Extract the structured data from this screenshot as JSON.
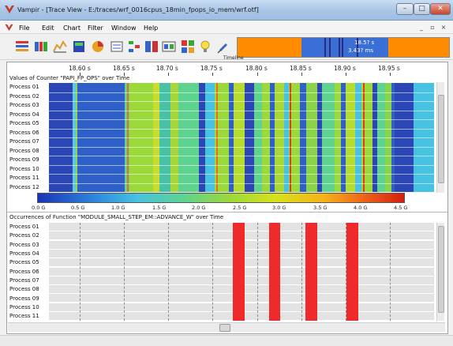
{
  "window": {
    "title": "Vampir - [Trace View - E:/traces/wrf_0016cpus_18min_fpops_io_mem/wrf.otf]",
    "min_glyph": "–",
    "max_glyph": "□",
    "close_glyph": "✕"
  },
  "menu": {
    "items": [
      "File",
      "Edit",
      "Chart",
      "Filter",
      "Window",
      "Help"
    ],
    "mdi_min": "_",
    "mdi_max": "▫",
    "mdi_close": "×"
  },
  "toolbar": {
    "buttons": [
      "master-timeline-icon",
      "process-timeline-icon",
      "counter-timeline-icon",
      "summary-chart-icon",
      "pie-chart-icon",
      "message-statistics-icon",
      "call-tree-icon",
      "process-summary-icon",
      "io-statistics-icon",
      "communication-matrix-icon",
      "idea-bulb-icon",
      "pin-icon"
    ],
    "timeline_caption": "Timeline",
    "overview_label_1": "18.5? s",
    "overview_label_2": "3.43? ms"
  },
  "ruler": {
    "labels": [
      "18.60 s",
      "18.65 s",
      "18.70 s",
      "18.75 s",
      "18.80 s",
      "18.85 s",
      "18.90 s",
      "18.95 s"
    ]
  },
  "counter_chart": {
    "title": "Values of Counter \"PAPI_FP_OPS\" over Time",
    "processes": [
      "Process 01",
      "Process 02",
      "Process 03",
      "Process 04",
      "Process 05",
      "Process 06",
      "Process 07",
      "Process 08",
      "Process 09",
      "Process 10",
      "Process 11",
      "Process 12"
    ],
    "legend_labels": [
      "0.0 G",
      "0.5 G",
      "1.0 G",
      "1.5 G",
      "2.0 G",
      "2.5 G",
      "3.0 G",
      "3.5 G",
      "4.0 G",
      "4.5 G"
    ]
  },
  "function_chart": {
    "title": "Occurrences of Function \"MODULE_SMALL_STEP_EM::ADVANCE_W\" over Time",
    "processes": [
      "Process 01",
      "Process 02",
      "Process 03",
      "Process 04",
      "Process 05",
      "Process 06",
      "Process 07",
      "Process 08",
      "Process 09",
      "Process 10",
      "Process 11"
    ]
  },
  "colors": {
    "function_block": "#ee2a2a",
    "counter_low": "#2b47b5",
    "counter_high": "#d61e10"
  }
}
